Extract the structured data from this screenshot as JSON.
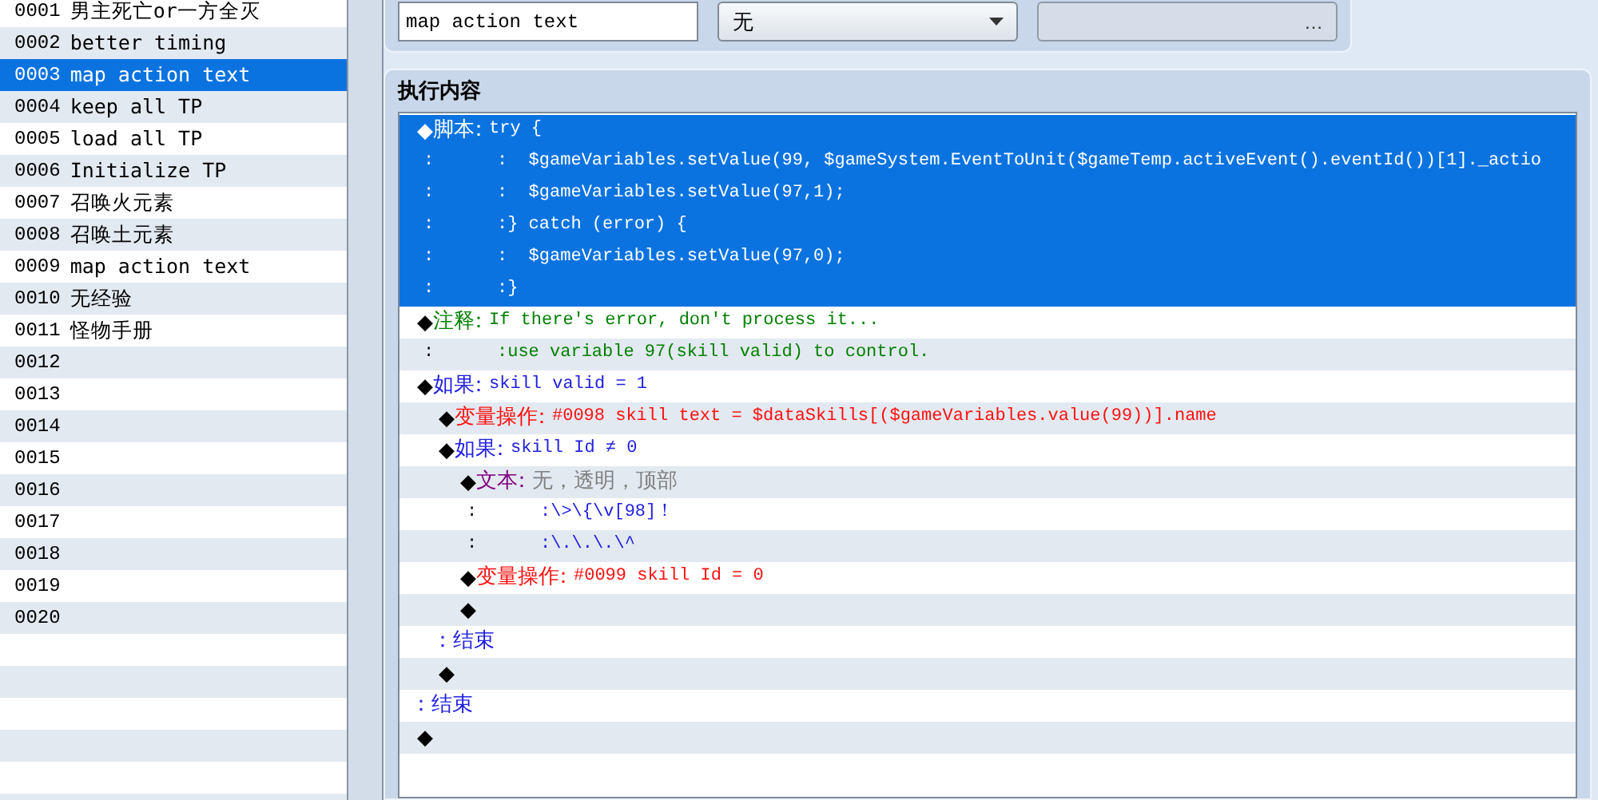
{
  "event_list": {
    "items": [
      {
        "number": "0001",
        "name": "男主死亡or一方全灭",
        "selected": false
      },
      {
        "number": "0002",
        "name": "better timing",
        "selected": false
      },
      {
        "number": "0003",
        "name": "map action text",
        "selected": true
      },
      {
        "number": "0004",
        "name": "keep all TP",
        "selected": false
      },
      {
        "number": "0005",
        "name": "load all TP",
        "selected": false
      },
      {
        "number": "0006",
        "name": "Initialize TP",
        "selected": false
      },
      {
        "number": "0007",
        "name": "召唤火元素",
        "selected": false
      },
      {
        "number": "0008",
        "name": "召唤土元素",
        "selected": false
      },
      {
        "number": "0009",
        "name": "map action text",
        "selected": false
      },
      {
        "number": "0010",
        "name": "无经验",
        "selected": false
      },
      {
        "number": "0011",
        "name": "怪物手册",
        "selected": false
      },
      {
        "number": "0012",
        "selected": false
      },
      {
        "number": "0013",
        "selected": false
      },
      {
        "number": "0014",
        "selected": false
      },
      {
        "number": "0015",
        "selected": false
      },
      {
        "number": "0016",
        "selected": false
      },
      {
        "number": "0017",
        "selected": false
      },
      {
        "number": "0018",
        "selected": false
      },
      {
        "number": "0019",
        "selected": false
      },
      {
        "number": "0020",
        "selected": false
      }
    ]
  },
  "name_field": {
    "value": "map action text"
  },
  "trigger_dropdown": {
    "value": "无"
  },
  "switch_field": {
    "button": "…"
  },
  "contents": {
    "title": "执行内容",
    "commands": [
      {
        "kind": "script",
        "bullet": "◆",
        "head": "脚本",
        "sep": "：",
        "text": "try {",
        "selected": true,
        "continuation": [
          {
            "lead": ":",
            "sep": ":",
            "text": "  $gameVariables.setValue(99, $gameSystem.EventToUnit($gameTemp.activeEvent().eventId())[1]._actio"
          },
          {
            "lead": ":",
            "sep": ":",
            "text": "  $gameVariables.setValue(97,1);"
          },
          {
            "lead": ":",
            "sep": ":",
            "text": "} catch (error) {"
          },
          {
            "lead": ":",
            "sep": ":",
            "text": "  $gameVariables.setValue(97,0);"
          },
          {
            "lead": ":",
            "sep": ":",
            "text": "}"
          }
        ]
      },
      {
        "kind": "comment",
        "bullet": "◆",
        "head": "注释",
        "sep": "：",
        "text": "If there's error, don't process it...",
        "selected": false,
        "continuation": [
          {
            "lead": ":",
            "sep": ":",
            "text": "use variable 97(skill valid) to control."
          }
        ]
      },
      {
        "kind": "branch",
        "bullet": "◆",
        "head": "如果",
        "sep": "：",
        "text": "skill valid = 1",
        "selected": false,
        "children": [
          {
            "kind": "variable",
            "bullet": "◆",
            "head": "变量操作",
            "sep": "：",
            "text": "#0098 skill text = $dataSkills[($gameVariables.value(99))].name",
            "selected": false
          },
          {
            "kind": "branch",
            "bullet": "◆",
            "head": "如果",
            "sep": "：",
            "text": "skill Id ≠ 0",
            "selected": false,
            "children": [
              {
                "kind": "message",
                "bullet": "◆",
                "head": "文本",
                "sep": "：",
                "text": "无，透明，顶部",
                "selected": false,
                "continuation": [
                  {
                    "lead": ":",
                    "sep": ":",
                    "text": "\\>\\{\\v[98]！"
                  },
                  {
                    "lead": ":",
                    "sep": ":",
                    "text": "\\.\\.\\.\\^"
                  }
                ]
              },
              {
                "kind": "variable",
                "bullet": "◆",
                "head": "变量操作",
                "sep": "：",
                "text": "#0099 skill Id = 0",
                "selected": false
              },
              {
                "kind": "empty",
                "bullet": "◆",
                "selected": false
              }
            ],
            "end": {
              "sep": "：",
              "label": "结束"
            }
          },
          {
            "kind": "empty",
            "bullet": "◆",
            "selected": false
          }
        ],
        "end": {
          "sep": "：",
          "label": "结束"
        }
      },
      {
        "kind": "empty",
        "bullet": "◆",
        "selected": false
      }
    ]
  }
}
